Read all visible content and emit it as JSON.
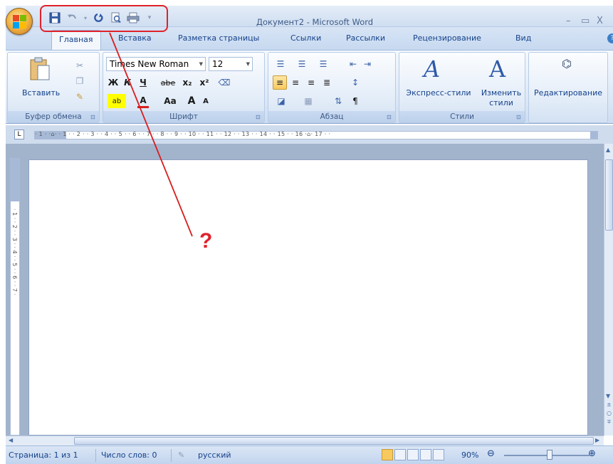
{
  "window": {
    "title": "Документ2 - Microsoft Word",
    "minimize": "–",
    "restore": "▭",
    "close": "X"
  },
  "quick_access": {
    "save": "save-icon",
    "undo": "undo-icon",
    "redo": "redo-icon",
    "print_preview": "print-preview-icon",
    "print": "print-icon"
  },
  "tabs": [
    {
      "label": "Главная",
      "active": true
    },
    {
      "label": "Вставка"
    },
    {
      "label": "Разметка страницы"
    },
    {
      "label": "Ссылки"
    },
    {
      "label": "Рассылки"
    },
    {
      "label": "Рецензирование"
    },
    {
      "label": "Вид"
    }
  ],
  "ribbon": {
    "clipboard": {
      "label": "Буфер обмена",
      "paste": "Вставить"
    },
    "font": {
      "label": "Шрифт",
      "font_name": "Times New Roman",
      "font_size": "12",
      "bold": "Ж",
      "italic": "К",
      "underline": "Ч",
      "strike": "abe",
      "subscript": "x₂",
      "superscript": "x²",
      "case": "Aa",
      "grow": "A",
      "shrink": "A"
    },
    "paragraph": {
      "label": "Абзац",
      "pilcrow": "¶"
    },
    "styles": {
      "label": "Стили",
      "quick_styles": "Экспресс-стили",
      "change_styles_1": "Изменить",
      "change_styles_2": "стили"
    },
    "editing": {
      "label": "Редактирование"
    }
  },
  "ruler": {
    "numbers": "· 1 · ·⌂· · 1 · · 2 · · 3 · · 4 · · 5 · · 6 · · 7 · · 8 · · 9 · · 10 · · 11 · · 12 · · 13 · · 14 · · 15 · · 16 ·⌂· 17 · ·",
    "vertical": "· 1 · · 2 · · 3 · · 4 · · 5 · · 6 · · 7 ·"
  },
  "statusbar": {
    "page": "Страница: 1 из 1",
    "words": "Число слов: 0",
    "language": "русский",
    "zoom": "90%"
  },
  "annotation": {
    "question": "?"
  },
  "colors": {
    "accent": "#15428b",
    "highlight": "#e0222a"
  }
}
